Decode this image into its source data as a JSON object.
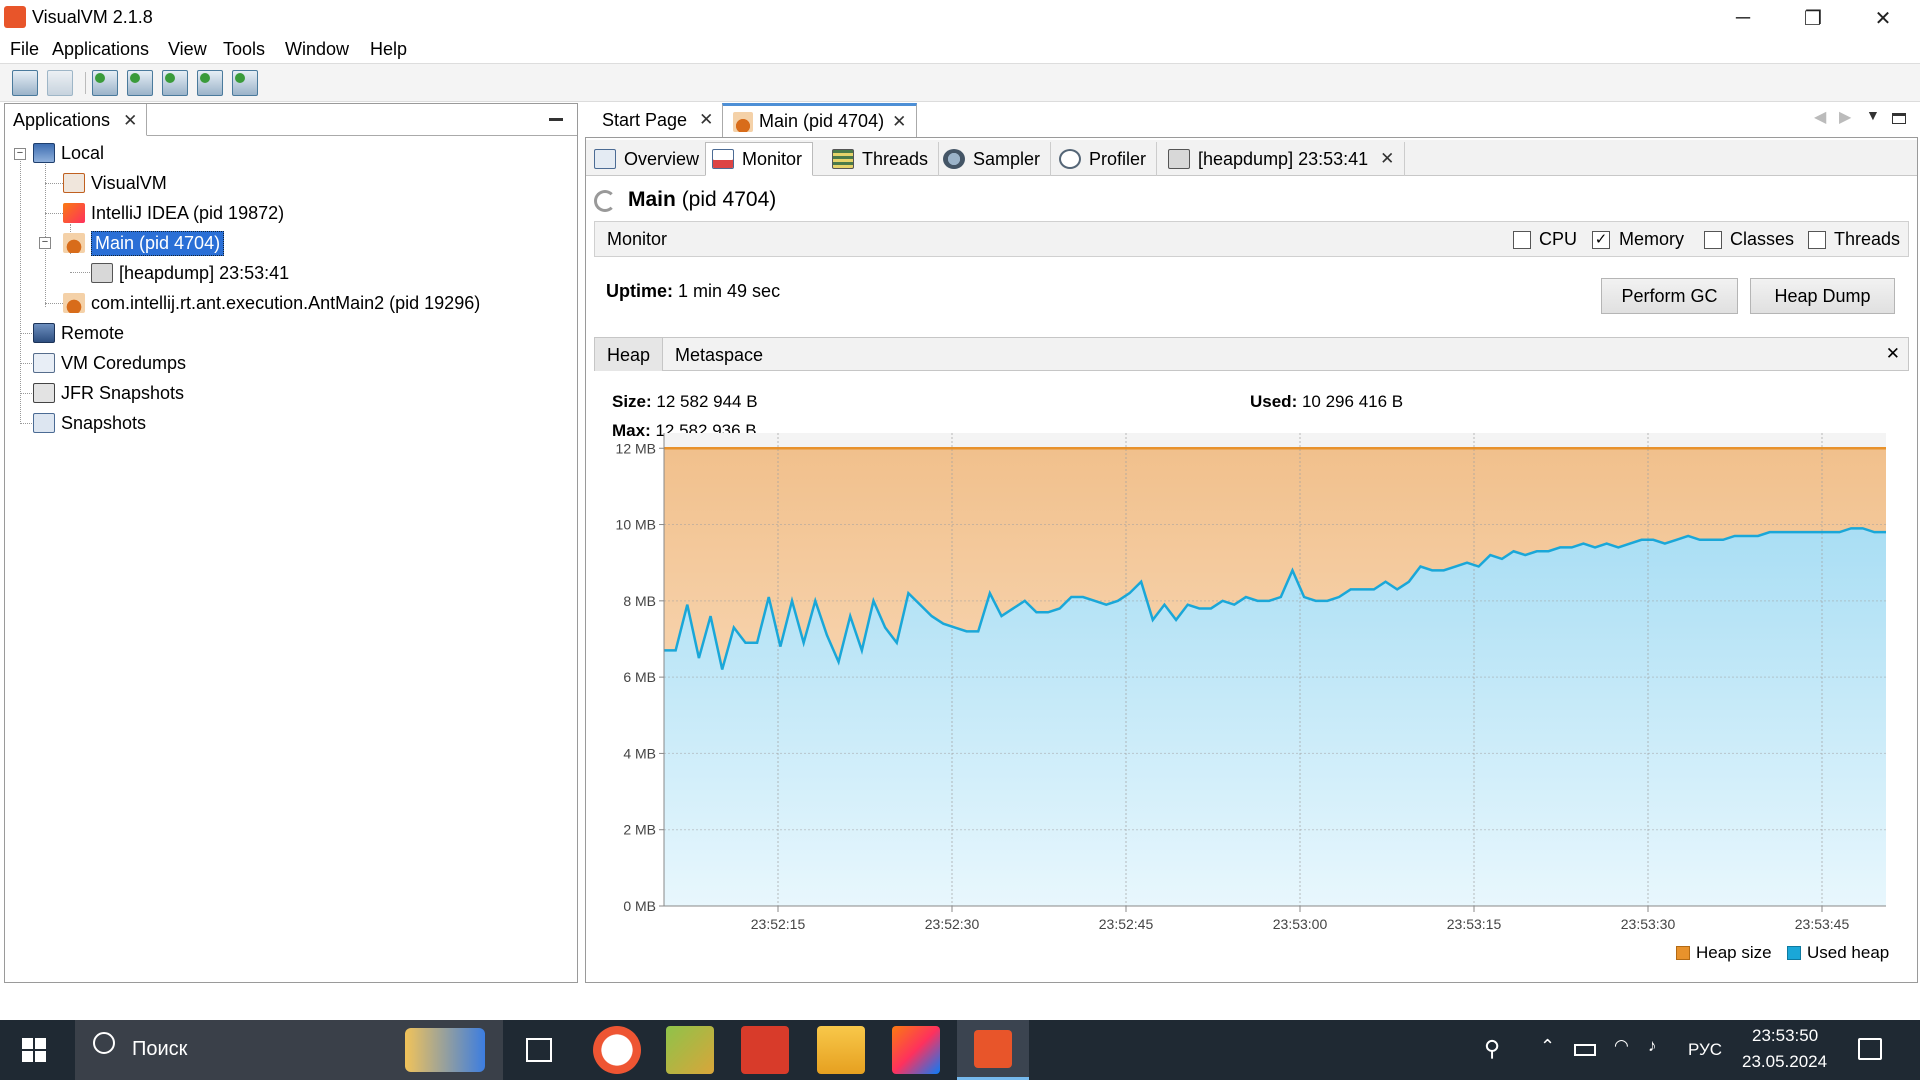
{
  "window": {
    "title": "VisualVM 2.1.8",
    "minimize": "─",
    "maximize": "❐",
    "close": "✕"
  },
  "menu": [
    "File",
    "Applications",
    "View",
    "Tools",
    "Window",
    "Help"
  ],
  "left_panel": {
    "tab_label": "Applications",
    "tree": {
      "local": "Local",
      "visualvm": "VisualVM",
      "intellij": "IntelliJ IDEA (pid 19872)",
      "main": "Main (pid 4704)",
      "heapdump": "[heapdump] 23:53:41",
      "antmain": "com.intellij.rt.ant.execution.AntMain2 (pid 19296)",
      "remote": "Remote",
      "coredumps": "VM Coredumps",
      "jfr": "JFR Snapshots",
      "snapshots": "Snapshots"
    }
  },
  "doc_tabs": {
    "start_page": "Start Page",
    "main": "Main (pid 4704)"
  },
  "sub_tabs": {
    "overview": "Overview",
    "monitor": "Monitor",
    "threads": "Threads",
    "sampler": "Sampler",
    "profiler": "Profiler",
    "heapdump": "[heapdump] 23:53:41"
  },
  "process": {
    "name": "Main",
    "pid": "(pid 4704)"
  },
  "monitor": {
    "label": "Monitor",
    "checkboxes": {
      "cpu": "CPU",
      "memory": "Memory",
      "classes": "Classes",
      "threads": "Threads"
    },
    "checked": {
      "cpu": false,
      "memory": true,
      "classes": false,
      "threads": false
    },
    "uptime_label": "Uptime:",
    "uptime_value": "1 min 49 sec",
    "perform_gc": "Perform GC",
    "heap_dump": "Heap Dump"
  },
  "heap_tabs": {
    "heap": "Heap",
    "metaspace": "Metaspace"
  },
  "heap_stats": {
    "size_label": "Size:",
    "size_value": "12 582 944 B",
    "used_label": "Used:",
    "used_value": "10 296 416 B",
    "max_label": "Max:",
    "max_value": "12 582 936 B"
  },
  "chart_data": {
    "type": "area",
    "y_ticks": [
      "0 MB",
      "2 MB",
      "4 MB",
      "6 MB",
      "8 MB",
      "10 MB",
      "12 MB"
    ],
    "ylim": [
      0,
      12.4
    ],
    "x_ticks": [
      "23:52:15",
      "23:52:30",
      "23:52:45",
      "23:53:00",
      "23:53:15",
      "23:53:30",
      "23:53:45"
    ],
    "grid": true,
    "legend_position": "bottom-right",
    "series": [
      {
        "name": "Heap size",
        "color": "#e8922c",
        "values": [
          12.0,
          12.0,
          12.0,
          12.0,
          12.0,
          12.0,
          12.0,
          12.0,
          12.0,
          12.0,
          12.0,
          12.0,
          12.0,
          12.0,
          12.0,
          12.0,
          12.0,
          12.0,
          12.0,
          12.0,
          12.0,
          12.0,
          12.0,
          12.0,
          12.0,
          12.0,
          12.0,
          12.0,
          12.0,
          12.0,
          12.0,
          12.0,
          12.0,
          12.0,
          12.0,
          12.0,
          12.0,
          12.0,
          12.0,
          12.0,
          12.0,
          12.0,
          12.0,
          12.0,
          12.0,
          12.0,
          12.0,
          12.0,
          12.0,
          12.0,
          12.0,
          12.0,
          12.0,
          12.0,
          12.0,
          12.0,
          12.0,
          12.0,
          12.0,
          12.0,
          12.0,
          12.0,
          12.0,
          12.0,
          12.0,
          12.0,
          12.0,
          12.0,
          12.0,
          12.0,
          12.0,
          12.0,
          12.0,
          12.0,
          12.0,
          12.0,
          12.0,
          12.0,
          12.0,
          12.0,
          12.0,
          12.0,
          12.0,
          12.0,
          12.0,
          12.0,
          12.0,
          12.0,
          12.0,
          12.0,
          12.0,
          12.0,
          12.0,
          12.0,
          12.0,
          12.0,
          12.0,
          12.0,
          12.0,
          12.0,
          12.0,
          12.0,
          12.0,
          12.0,
          12.0,
          12.0
        ]
      },
      {
        "name": "Used heap",
        "color": "#1aa7d8",
        "values": [
          6.7,
          6.7,
          7.9,
          6.5,
          7.6,
          6.2,
          7.3,
          6.9,
          6.9,
          8.1,
          6.8,
          8.0,
          6.9,
          8.0,
          7.1,
          6.4,
          7.6,
          6.7,
          8.0,
          7.3,
          6.9,
          8.2,
          7.9,
          7.6,
          7.4,
          7.3,
          7.2,
          7.2,
          8.2,
          7.6,
          7.8,
          8.0,
          7.7,
          7.7,
          7.8,
          8.1,
          8.1,
          8.0,
          7.9,
          8.0,
          8.2,
          8.5,
          7.5,
          7.9,
          7.5,
          7.9,
          7.8,
          7.8,
          8.0,
          7.9,
          8.1,
          8.0,
          8.0,
          8.1,
          8.8,
          8.1,
          8.0,
          8.0,
          8.1,
          8.3,
          8.3,
          8.3,
          8.5,
          8.3,
          8.5,
          8.9,
          8.8,
          8.8,
          8.9,
          9.0,
          8.9,
          9.2,
          9.1,
          9.3,
          9.2,
          9.3,
          9.3,
          9.4,
          9.4,
          9.5,
          9.4,
          9.5,
          9.4,
          9.5,
          9.6,
          9.6,
          9.5,
          9.6,
          9.7,
          9.6,
          9.6,
          9.6,
          9.7,
          9.7,
          9.7,
          9.8,
          9.8,
          9.8,
          9.8,
          9.8,
          9.8,
          9.8,
          9.9,
          9.9,
          9.8,
          9.8
        ]
      }
    ]
  },
  "taskbar": {
    "search_placeholder": "Поиск",
    "lang": "РУС",
    "time": "23:53:50",
    "date": "23.05.2024"
  }
}
